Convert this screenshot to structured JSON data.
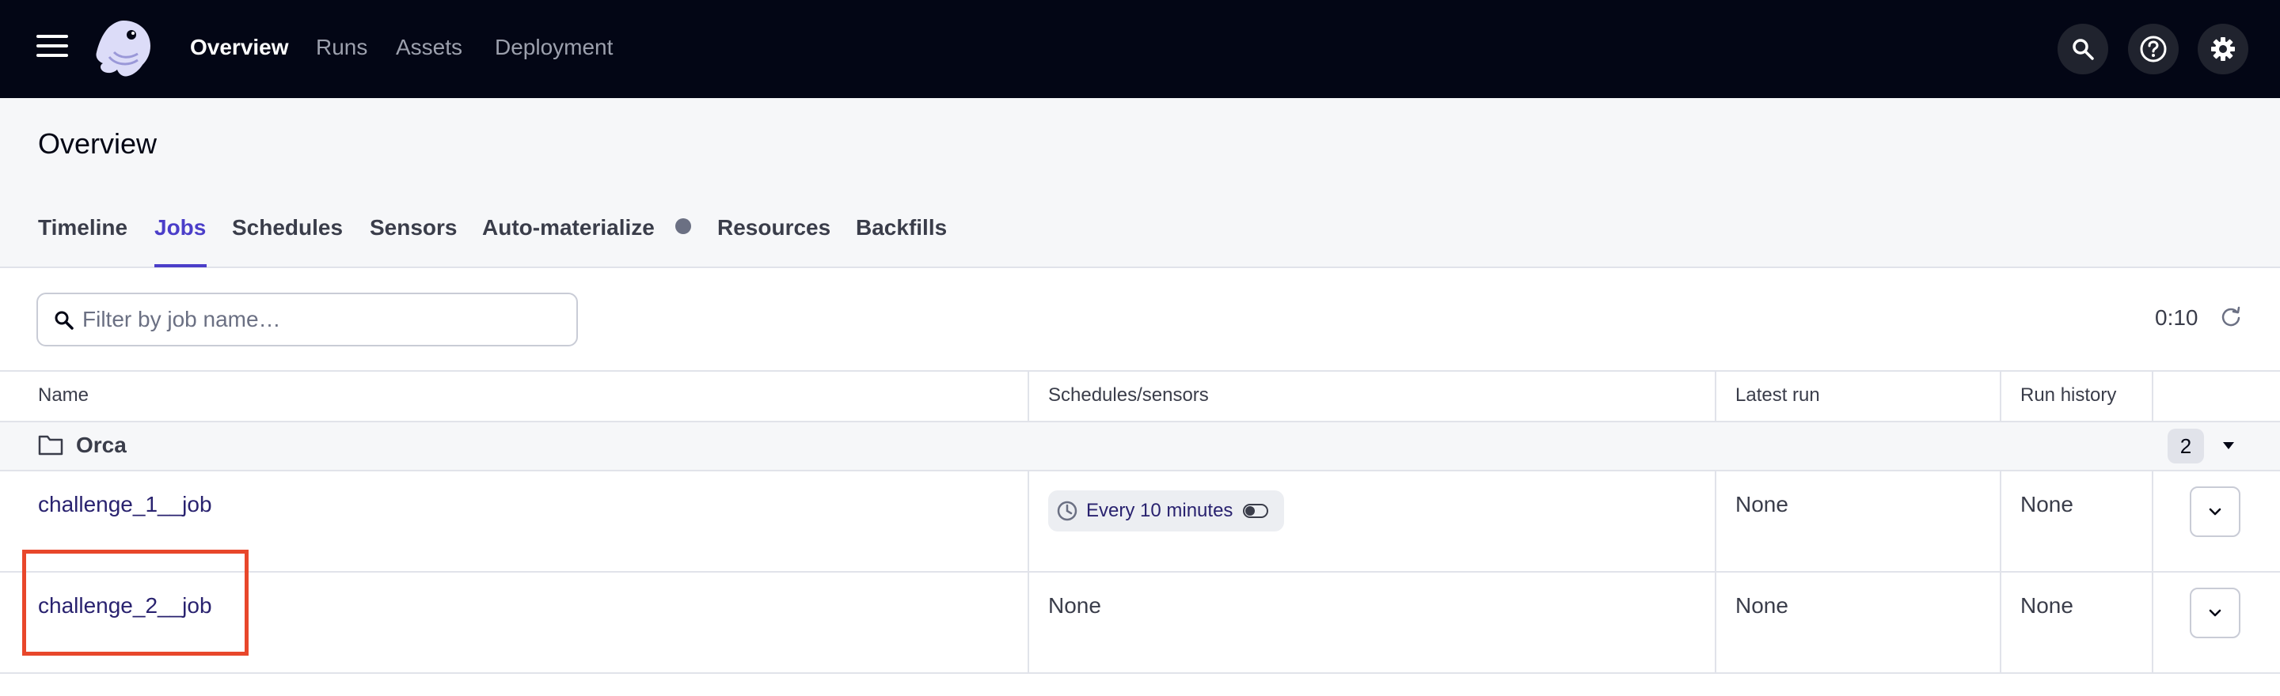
{
  "nav": {
    "menu_icon": "hamburger-menu-icon",
    "logo_icon": "dagster-logo-icon",
    "links": [
      {
        "label": "Overview",
        "active": true
      },
      {
        "label": "Runs",
        "active": false
      },
      {
        "label": "Assets",
        "active": false
      },
      {
        "label": "Deployment",
        "active": false
      }
    ],
    "right_icons": [
      "search-icon",
      "help-icon",
      "gear-icon"
    ]
  },
  "page": {
    "title": "Overview",
    "tabs": [
      {
        "label": "Timeline",
        "active": false
      },
      {
        "label": "Jobs",
        "active": true
      },
      {
        "label": "Schedules",
        "active": false
      },
      {
        "label": "Sensors",
        "active": false
      },
      {
        "label": "Auto-materialize",
        "active": false
      },
      {
        "label": "Resources",
        "active": false
      },
      {
        "label": "Backfills",
        "active": false
      }
    ]
  },
  "filter": {
    "placeholder": "Filter by job name…",
    "value": "",
    "refresh_countdown": "0:10"
  },
  "table": {
    "columns": [
      "Name",
      "Schedules/sensors",
      "Latest run",
      "Run history"
    ],
    "group": {
      "name": "Orca",
      "count": "2"
    },
    "rows": [
      {
        "name": "challenge_1__job",
        "schedule": "Every 10 minutes",
        "latest_run": "None",
        "run_history": "None"
      },
      {
        "name": "challenge_2__job",
        "schedule": "None",
        "latest_run": "None",
        "run_history": "None"
      }
    ]
  },
  "colors": {
    "nav_bg": "#030615",
    "accent": "#4b3ec9",
    "link": "#29226f",
    "highlight": "#e8472b"
  }
}
